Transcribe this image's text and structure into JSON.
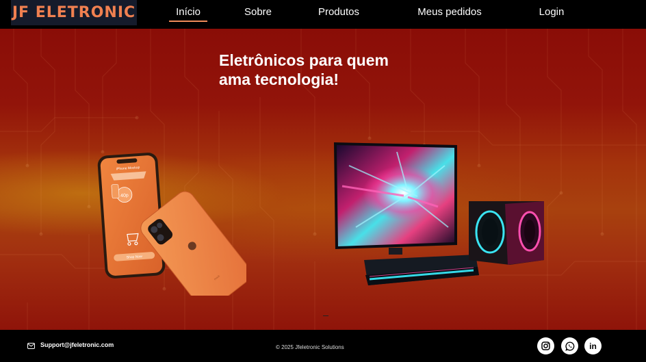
{
  "brand": {
    "logo_text": "JF ELETRONIC",
    "accent_color": "#f08050"
  },
  "nav": {
    "items": [
      {
        "label": "Início",
        "active": true
      },
      {
        "label": "Sobre",
        "active": false
      },
      {
        "label": "Produtos",
        "active": false
      },
      {
        "label": "Meus pedidos",
        "active": false
      },
      {
        "label": "Login",
        "active": false
      }
    ]
  },
  "hero": {
    "title_line1": "Eletrônicos para quem",
    "title_line2": "ama tecnologia!",
    "phone_price_badge": "40p",
    "phone_button_label": "Shop Now"
  },
  "footer": {
    "support_email": "Support@jfeletronic.com",
    "copyright": "© 2025 Jfeletronic Solutions",
    "social": [
      "instagram-icon",
      "whatsapp-icon",
      "linkedin-icon"
    ],
    "linkedin_label": "in"
  }
}
